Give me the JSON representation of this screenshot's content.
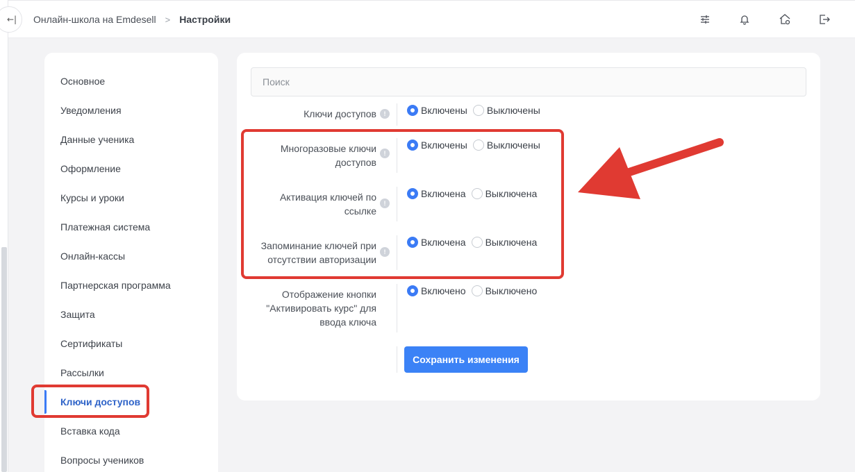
{
  "header": {
    "breadcrumb": {
      "home": "Онлайн-школа на Emdesell",
      "separator": ">",
      "current": "Настройки"
    },
    "icons": [
      "sliders-icon",
      "bell-icon",
      "home-settings-icon",
      "logout-icon"
    ]
  },
  "sidebar": {
    "items": [
      {
        "label": "Основное"
      },
      {
        "label": "Уведомления"
      },
      {
        "label": "Данные ученика"
      },
      {
        "label": "Оформление"
      },
      {
        "label": "Курсы и уроки"
      },
      {
        "label": "Платежная система"
      },
      {
        "label": "Онлайн-кассы"
      },
      {
        "label": "Партнерская программа"
      },
      {
        "label": "Защита"
      },
      {
        "label": "Сертификаты"
      },
      {
        "label": "Рассылки"
      },
      {
        "label": "Ключи доступов",
        "active": true
      },
      {
        "label": "Вставка кода"
      },
      {
        "label": "Вопросы учеников"
      }
    ]
  },
  "main": {
    "search": {
      "placeholder": "Поиск",
      "value": ""
    },
    "settings": [
      {
        "label": "Ключи доступов",
        "on_label": "Включены",
        "off_label": "Выключены",
        "selected": "on"
      },
      {
        "label": "Многоразовые ключи доступов",
        "on_label": "Включены",
        "off_label": "Выключены",
        "selected": "on"
      },
      {
        "label": "Активация ключей по ссылке",
        "on_label": "Включена",
        "off_label": "Выключена",
        "selected": "on"
      },
      {
        "label": "Запоминание ключей при отсутствии авторизации",
        "on_label": "Включена",
        "off_label": "Выключена",
        "selected": "on"
      },
      {
        "label": "Отображение кнопки \"Активировать курс\" для ввода ключа",
        "on_label": "Включено",
        "off_label": "Выключено",
        "selected": "on"
      }
    ],
    "info_glyph": "!",
    "save_label": "Сохранить изменения"
  },
  "colors": {
    "accent": "#3b82f6",
    "annotation": "#e03a32"
  }
}
